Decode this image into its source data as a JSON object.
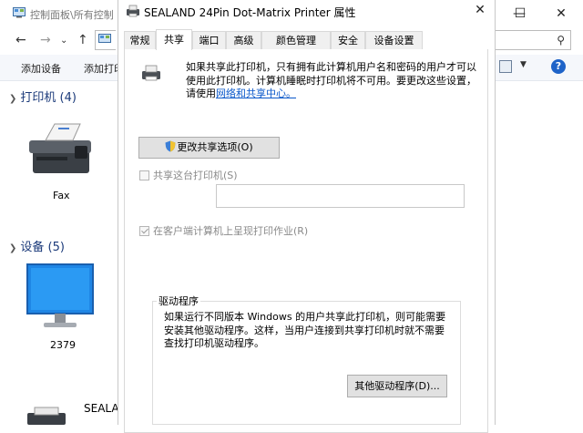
{
  "explorer": {
    "title": "控制面板\\所有控制",
    "toolbar": {
      "add_device": "添加设备",
      "add_printer": "添加打印"
    },
    "printers_group": {
      "label": "打印机 (4)"
    },
    "devices_group": {
      "label": "设备 (5)"
    },
    "devices": {
      "fax": "Fax",
      "computer": "2379",
      "sealand": "SEALA"
    }
  },
  "dialog": {
    "title": "SEALAND 24Pin Dot-Matrix Printer 属性",
    "tabs": [
      "常规",
      "共享",
      "端口",
      "高级",
      "颜色管理",
      "安全",
      "设备设置"
    ],
    "active_tab": "共享",
    "description": "如果共享此打印机，只有拥有此计算机用户名和密码的用户才可以使用此打印机。计算机睡眠时打印机将不可用。要更改这些设置，请使用",
    "description_link": "网络和共享中心。",
    "change_sharing_button": "更改共享选项(O)",
    "share_checkbox": "共享这台打印机(S)",
    "share_name_value": "",
    "render_jobs_checkbox": "在客户端计算机上呈现打印作业(R)",
    "drivers": {
      "legend": "驱动程序",
      "text": "如果运行不同版本 Windows 的用户共享此打印机，则可能需要安装其他驱动程序。这样，当用户连接到共享打印机时就不需要查找打印机驱动程序。",
      "button": "其他驱动程序(D)..."
    }
  }
}
